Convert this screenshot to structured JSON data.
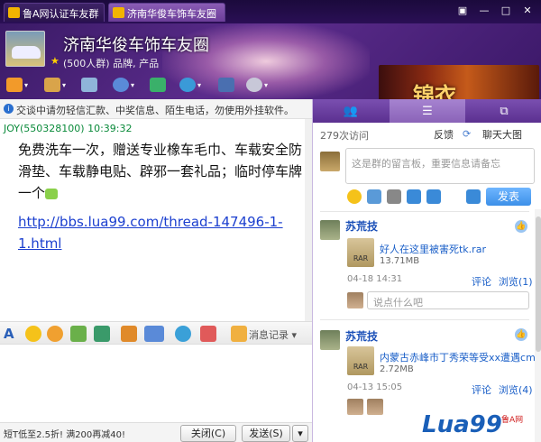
{
  "tabs": [
    {
      "label": "鲁A网认证车友群"
    },
    {
      "label": "济南华俊车饰车友圈"
    }
  ],
  "window": {
    "menu": "▣",
    "minimize": "—",
    "maximize": "□",
    "close": "✕"
  },
  "group": {
    "title": "济南华俊车饰车友圈",
    "subtitle": "(500人群) 品牌, 产品",
    "star": "★"
  },
  "ad": {
    "text": "锦衣"
  },
  "notice": {
    "text": "交谈中请勿轻信汇款、中奖信息、陌生电话，勿使用外挂软件。",
    "icon": "i"
  },
  "message": {
    "sender": "JOY(550328100)  10:39:32",
    "text": "免费洗车一次，赠送专业橡车毛巾、车载安全防滑垫、车载静电贴、辟邪一套礼品；临时停车牌一个",
    "link": "http://bbs.lua99.com/thread-147496-1-1.html"
  },
  "compose": {
    "history_label": "消息记录",
    "history_arrow": "▾"
  },
  "bottom": {
    "promo": "短T低至2.5折! 满200再减40!",
    "close_label": "关闭(C)",
    "send_label": "发送(S)",
    "send_arrow": "▾"
  },
  "sidebar": {
    "tabs": [
      {
        "icon": "members-icon",
        "glyph": "👥"
      },
      {
        "icon": "list-icon",
        "glyph": "☰"
      },
      {
        "icon": "window-icon",
        "glyph": "⧉"
      }
    ],
    "visits": "279次访问",
    "feedback": "反馈",
    "refresh": "⟳",
    "chat_map": "聊天大图",
    "post_placeholder": "这是群的留言板，重要信息请备忘",
    "send_label": "发表",
    "posts": [
      {
        "name": "苏荒技",
        "file": "好人在这里被害死tk.rar",
        "size": "13.71MB",
        "file_label": "RAR",
        "date": "04-18 14:31",
        "comment": "评论",
        "browse": "浏览(1)",
        "comment_placeholder": "说点什么吧",
        "likes": "👍"
      },
      {
        "name": "苏荒技",
        "file": "内蒙古赤峰市丁秀荣等受xx遭遇cm",
        "size": "2.72MB",
        "file_label": "RAR",
        "date": "04-13 15:05",
        "comment": "评论",
        "browse": "浏览(4)",
        "likes": "👍"
      }
    ]
  },
  "watermark": {
    "text": "Lua99",
    "sub": "鲁A网"
  }
}
